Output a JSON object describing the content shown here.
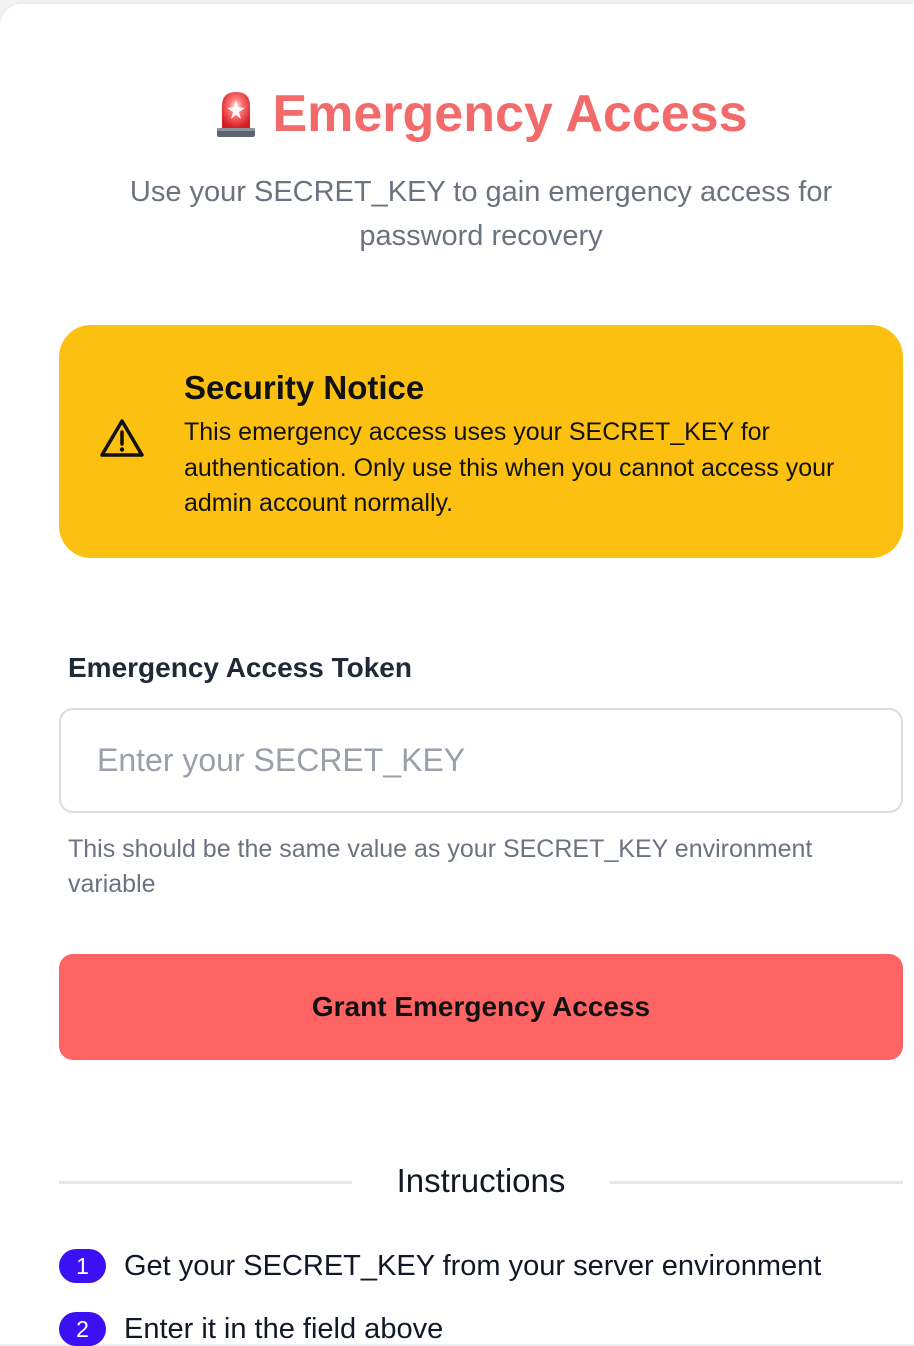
{
  "header": {
    "title": "Emergency Access",
    "subtitle": "Use your SECRET_KEY to gain emergency access for password recovery",
    "icon": "siren-icon"
  },
  "notice": {
    "title": "Security Notice",
    "body": "This emergency access uses your SECRET_KEY for authentication. Only use this when you cannot access your admin account normally.",
    "icon": "warning-triangle-icon",
    "background": "#fcc010"
  },
  "form": {
    "label": "Emergency Access Token",
    "placeholder": "Enter your SECRET_KEY",
    "value": "",
    "help": "This should be the same value as your SECRET_KEY environment variable",
    "submit_label": "Grant Emergency Access",
    "submit_color": "#fe6463"
  },
  "instructions": {
    "heading": "Instructions",
    "steps": [
      {
        "number": "1",
        "text": "Get your SECRET_KEY from your server environment"
      },
      {
        "number": "2",
        "text": "Enter it in the field above"
      }
    ],
    "badge_color": "#3b10f5"
  }
}
